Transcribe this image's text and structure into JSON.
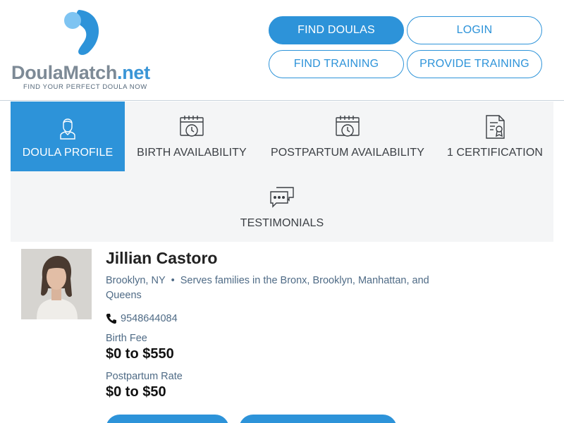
{
  "logo": {
    "brand": "Doula",
    "brand2": "Match",
    "tld": ".net",
    "tagline": "FIND YOUR PERFECT DOULA NOW"
  },
  "nav": {
    "find_doulas": "FIND DOULAS",
    "login": "LOGIN",
    "find_training": "FIND TRAINING",
    "provide_training": "PROVIDE TRAINING"
  },
  "tabs": [
    {
      "label": "DOULA PROFILE",
      "icon": "doula-avatar-icon",
      "active": true
    },
    {
      "label": "BIRTH AVAILABILITY",
      "icon": "calendar-clock-icon",
      "active": false
    },
    {
      "label": "POSTPARTUM AVAILABILITY",
      "icon": "calendar-clock-icon",
      "active": false
    },
    {
      "label": "1 CERTIFICATION",
      "icon": "certificate-icon",
      "active": false
    },
    {
      "label": "TESTIMONIALS",
      "icon": "chat-bubbles-icon",
      "active": false
    }
  ],
  "profile": {
    "name": "Jillian Castoro",
    "city": "Brooklyn, NY",
    "serves": "Serves families in the Bronx, Brooklyn, Manhattan, and Queens",
    "phone": "9548644084",
    "birth_fee_label": "Birth Fee",
    "birth_fee": "$0 to $550",
    "postpartum_label": "Postpartum Rate",
    "postpartum_rate": "$0 to $50"
  },
  "colors": {
    "accent": "#2d93d9",
    "text_muted": "#4f6b86",
    "tab_bg": "#f4f5f6"
  }
}
